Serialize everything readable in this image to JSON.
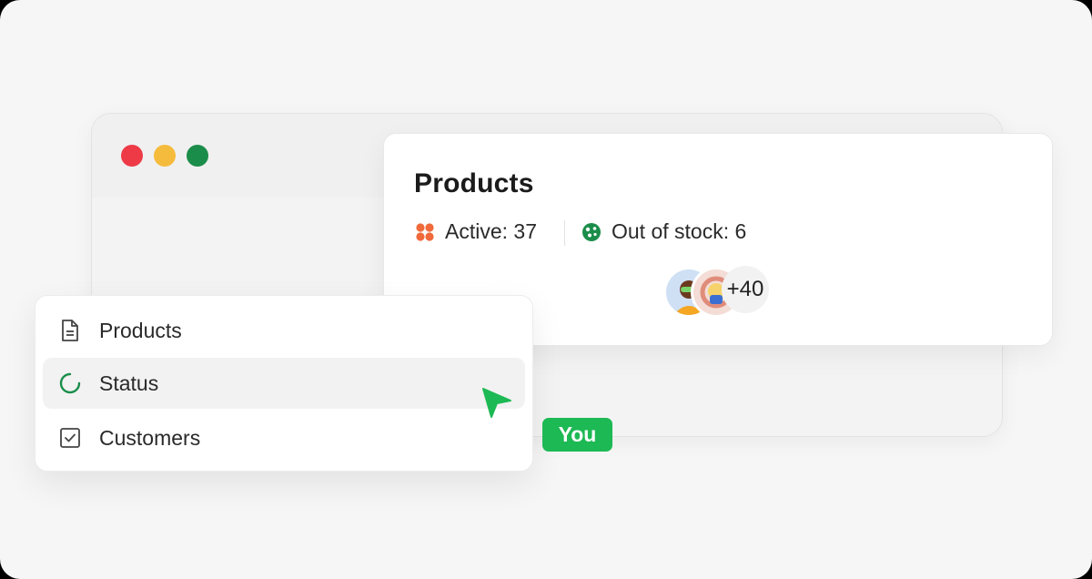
{
  "window": {
    "controls": [
      "close",
      "minimize",
      "zoom"
    ]
  },
  "card": {
    "title": "Products",
    "active_label": "Active: 37",
    "out_of_stock_label": "Out of stock: 6",
    "active_icon": "grid-icon",
    "out_of_stock_icon": "chart-icon",
    "avatars_more": "+40"
  },
  "menu": {
    "items": [
      {
        "label": "Products",
        "icon": "document-icon"
      },
      {
        "label": "Status",
        "icon": "loading-icon"
      },
      {
        "label": "Customers",
        "icon": "checkbox-icon"
      }
    ]
  },
  "cursor": {
    "label": "You",
    "color": "#1db954"
  },
  "colors": {
    "red": "#ee3a47",
    "yellow": "#f5bb3c",
    "green": "#1b8d4a",
    "accent_orange": "#f06a3b"
  }
}
